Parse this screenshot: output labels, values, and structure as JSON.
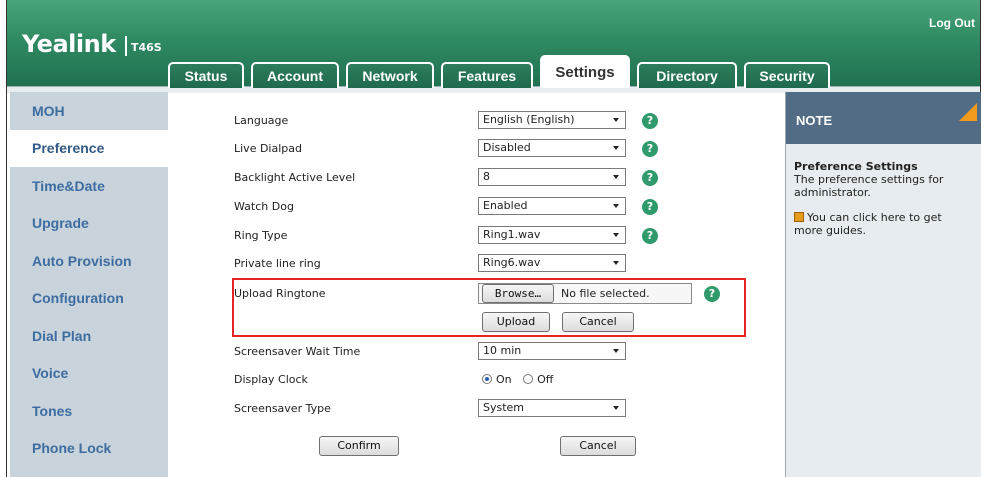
{
  "header": {
    "logo": "Yealink",
    "model": "T46S",
    "logout": "Log Out"
  },
  "tabs": [
    {
      "label": "Status"
    },
    {
      "label": "Account"
    },
    {
      "label": "Network"
    },
    {
      "label": "Features"
    },
    {
      "label": "Settings",
      "active": true
    },
    {
      "label": "Directory"
    },
    {
      "label": "Security"
    }
  ],
  "sidebar": {
    "items": [
      {
        "label": "MOH"
      },
      {
        "label": "Preference",
        "active": true
      },
      {
        "label": "Time&Date"
      },
      {
        "label": "Upgrade"
      },
      {
        "label": "Auto Provision"
      },
      {
        "label": "Configuration"
      },
      {
        "label": "Dial Plan"
      },
      {
        "label": "Voice"
      },
      {
        "label": "Tones"
      },
      {
        "label": "Phone Lock"
      }
    ]
  },
  "form": {
    "language": {
      "label": "Language",
      "value": "English (English)"
    },
    "live_dialpad": {
      "label": "Live Dialpad",
      "value": "Disabled"
    },
    "backlight": {
      "label": "Backlight Active Level",
      "value": "8"
    },
    "watch_dog": {
      "label": "Watch Dog",
      "value": "Enabled"
    },
    "ring_type": {
      "label": "Ring Type",
      "value": "Ring1.wav"
    },
    "private_line_ring": {
      "label": "Private line ring",
      "value": "Ring6.wav"
    },
    "upload_ringtone": {
      "label": "Upload Ringtone",
      "browse": "Browse…",
      "file_status": "No file selected.",
      "upload": "Upload",
      "cancel": "Cancel"
    },
    "screensaver_wait": {
      "label": "Screensaver Wait Time",
      "value": "10 min"
    },
    "display_clock": {
      "label": "Display Clock",
      "on": "On",
      "off": "Off",
      "selected": "On"
    },
    "screensaver_type": {
      "label": "Screensaver Type",
      "value": "System"
    },
    "confirm": "Confirm",
    "cancel": "Cancel",
    "help_glyph": "?"
  },
  "note": {
    "title": "NOTE",
    "heading": "Preference Settings",
    "text": "The preference settings for administrator.",
    "guide": "You can click here to get more guides."
  },
  "colors": {
    "header": "#2f8a62",
    "highlight": "#e52424",
    "accent": "#f39a1d"
  }
}
